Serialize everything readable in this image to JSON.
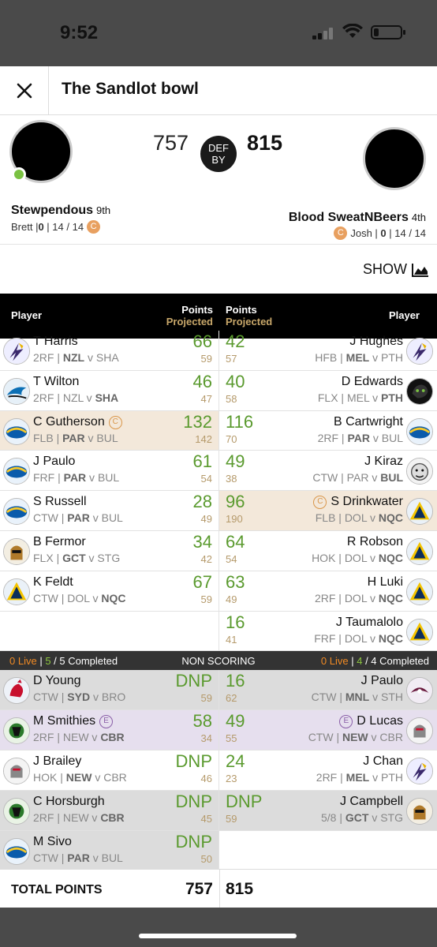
{
  "status_bar": {
    "time": "9:52"
  },
  "header": {
    "title": "The Sandlot bowl"
  },
  "match": {
    "left_score": "757",
    "right_score": "815",
    "result_label_1": "DEF",
    "result_label_2": "BY",
    "left_team": {
      "name": "Stewpendous",
      "rank": "9th",
      "owner": "Brett | ",
      "live": "0",
      "rest": " | 14 / 14",
      "badge": "C"
    },
    "right_team": {
      "name": "Blood SweatNBeers",
      "rank": "4th",
      "owner": "Josh | ",
      "live": "0",
      "rest": " | 14 / 14",
      "badge": "C"
    }
  },
  "show_label": "SHOW",
  "table_header": {
    "player": "Player",
    "points": "Points",
    "projected": "Projected"
  },
  "scoring_rows": [
    {
      "left": {
        "name": "T Harris",
        "info": [
          "2RF | ",
          "NZL",
          " v SHA"
        ],
        "bold": 1,
        "pts": "66",
        "proj": "59",
        "logo": "storm"
      },
      "right": {
        "name": "J Hughes",
        "info": [
          "HFB | ",
          "MEL",
          " v PTH"
        ],
        "bold": 1,
        "pts": "42",
        "proj": "57",
        "logo": "storm"
      }
    },
    {
      "left": {
        "name": "T Wilton",
        "info": [
          "2RF | NZL v ",
          "SHA",
          ""
        ],
        "bold": 1,
        "pts": "46",
        "proj": "47",
        "logo": "sharks"
      },
      "right": {
        "name": "D Edwards",
        "info": [
          "FLX | MEL v ",
          "PTH",
          ""
        ],
        "bold": 1,
        "pts": "40",
        "proj": "58",
        "logo": "panthers"
      }
    },
    {
      "left": {
        "name": "C Gutherson",
        "badge": "C",
        "info": [
          "FLB | ",
          "PAR",
          " v BUL"
        ],
        "bold": 1,
        "pts": "132",
        "proj": "142",
        "logo": "eels",
        "hl": true
      },
      "right": {
        "name": "B Cartwright",
        "info": [
          "2RF | ",
          "PAR",
          " v BUL"
        ],
        "bold": 1,
        "pts": "116",
        "proj": "70",
        "logo": "eels"
      }
    },
    {
      "left": {
        "name": "J Paulo",
        "info": [
          "FRF | ",
          "PAR",
          " v BUL"
        ],
        "bold": 1,
        "pts": "61",
        "proj": "54",
        "logo": "eels"
      },
      "right": {
        "name": "J Kiraz",
        "info": [
          "CTW | PAR v ",
          "BUL",
          ""
        ],
        "bold": 1,
        "pts": "49",
        "proj": "38",
        "logo": "bulldogs"
      }
    },
    {
      "left": {
        "name": "S Russell",
        "info": [
          "CTW | ",
          "PAR",
          " v BUL"
        ],
        "bold": 1,
        "pts": "28",
        "proj": "49",
        "logo": "eels"
      },
      "right": {
        "name": "S Drinkwater",
        "badge": "C",
        "info": [
          "FLB | DOL v ",
          "NQC",
          ""
        ],
        "bold": 1,
        "pts": "96",
        "proj": "190",
        "logo": "cowboys",
        "hl": true
      }
    },
    {
      "left": {
        "name": "B Fermor",
        "info": [
          "FLX | ",
          "GCT",
          " v STG"
        ],
        "bold": 1,
        "pts": "34",
        "proj": "42",
        "logo": "titans"
      },
      "right": {
        "name": "R Robson",
        "info": [
          "HOK | DOL v ",
          "NQC",
          ""
        ],
        "bold": 1,
        "pts": "64",
        "proj": "54",
        "logo": "cowboys"
      }
    },
    {
      "left": {
        "name": "K Feldt",
        "info": [
          "CTW | DOL v ",
          "NQC",
          ""
        ],
        "bold": 1,
        "pts": "67",
        "proj": "59",
        "logo": "cowboys"
      },
      "right": {
        "name": "H Luki",
        "info": [
          "2RF | DOL v ",
          "NQC",
          ""
        ],
        "bold": 1,
        "pts": "63",
        "proj": "49",
        "logo": "cowboys"
      }
    },
    {
      "left": null,
      "right": {
        "name": "J Taumalolo",
        "info": [
          "FRF | DOL v ",
          "NQC",
          ""
        ],
        "bold": 1,
        "pts": "16",
        "proj": "41",
        "logo": "cowboys"
      }
    }
  ],
  "non_scoring_bar": {
    "left_live": "0 Live",
    "left_sep": " | ",
    "left_completed_num": "5",
    "left_completed_rest": " / 5 Completed",
    "center": "NON SCORING",
    "right_live": "0 Live",
    "right_sep": " | ",
    "right_completed_num": "4",
    "right_completed_rest": " / 4 Completed"
  },
  "bench_rows": [
    {
      "left": {
        "name": "D Young",
        "info": [
          "CTW | ",
          "SYD",
          " v BRO"
        ],
        "bold": 1,
        "pts": "DNP",
        "proj": "59",
        "logo": "roosters",
        "bg": "grey"
      },
      "right": {
        "name": "J Paulo",
        "info": [
          "CTW | ",
          "MNL",
          " v STH"
        ],
        "bold": 1,
        "pts": "16",
        "proj": "62",
        "logo": "sea-eagles",
        "bg": "grey"
      }
    },
    {
      "left": {
        "name": "M Smithies",
        "ebadge": "E",
        "info": [
          "2RF | NEW v ",
          "CBR",
          ""
        ],
        "bold": 1,
        "pts": "58",
        "proj": "34",
        "logo": "raiders",
        "bg": "purple"
      },
      "right": {
        "name": "D Lucas",
        "ebadge": "E",
        "info": [
          "CTW | ",
          "NEW",
          " v CBR"
        ],
        "bold": 1,
        "pts": "49",
        "proj": "55",
        "logo": "knights",
        "bg": "purple"
      }
    },
    {
      "left": {
        "name": "J Brailey",
        "info": [
          "HOK | ",
          "NEW",
          " v CBR"
        ],
        "bold": 1,
        "pts": "DNP",
        "proj": "46",
        "logo": "knights",
        "bg": "white"
      },
      "right": {
        "name": "J Chan",
        "info": [
          "2RF | ",
          "MEL",
          " v PTH"
        ],
        "bold": 1,
        "pts": "24",
        "proj": "23",
        "logo": "storm",
        "bg": "white"
      }
    },
    {
      "left": {
        "name": "C Horsburgh",
        "info": [
          "2RF | NEW v ",
          "CBR",
          ""
        ],
        "bold": 1,
        "pts": "DNP",
        "proj": "45",
        "logo": "raiders",
        "bg": "grey"
      },
      "right": {
        "name": "J Campbell",
        "info": [
          "5/8 | ",
          "GCT",
          " v STG"
        ],
        "bold": 1,
        "pts": "DNP",
        "proj": "59",
        "logo": "titans",
        "bg": "grey"
      }
    },
    {
      "left": {
        "name": "M Sivo",
        "info": [
          "CTW | ",
          "PAR",
          " v BUL"
        ],
        "bold": 1,
        "pts": "DNP",
        "proj": "50",
        "logo": "eels",
        "bg": "grey"
      },
      "right": null
    }
  ],
  "totals": {
    "label": "TOTAL POINTS",
    "left": "757",
    "right": "815"
  },
  "colors": {
    "points_green": "#5a9a2e",
    "projected_gold": "#b59a6b",
    "live_orange": "#f08a24",
    "completed_green": "#8dc63f"
  }
}
